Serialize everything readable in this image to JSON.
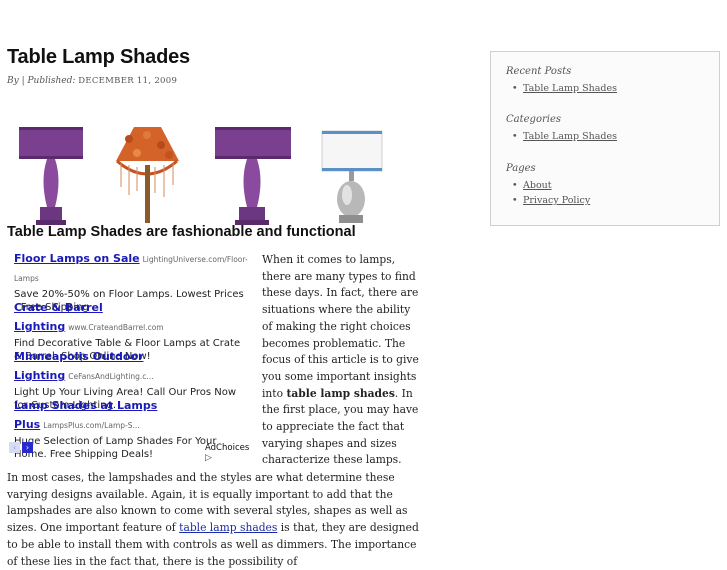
{
  "post": {
    "title": "Table Lamp Shades",
    "meta_by": "By",
    "meta_sep": " | ",
    "meta_published": "Published:",
    "meta_date": "DECEMBER 11, 2009",
    "subheading": "Table Lamp Shades are fashionable and functional",
    "side_para_1": "When it comes to lamps, there are many types to find these days. In fact, there are situations where the ability of making the right choices becomes problematic.  The focus of this article is to give you some important insights into",
    "side_para_bold": "table lamp shades",
    "side_para_2": ". In the first place, you may have to appreciate the fact that varying shapes and sizes characterize these lamps.",
    "body_para_1": "In most cases, the lampshades and the styles are what determine these varying designs available. Again, it is equally important to add that the lampshades are also known to come with several styles, shapes as well as sizes. One important feature of",
    "body_link": "table lamp shades",
    "body_para_2": "is that, they are designed to be able to install them with controls as well as dimmers.  The importance of these lies in the fact that, there is the possibility of"
  },
  "ads": {
    "items": [
      {
        "title": "Floor Lamps on Sale",
        "url": "LightingUniverse.com/Floor-Lamps",
        "desc": "Save 20%-50% on Floor Lamps. Lowest Prices - Free Shipping"
      },
      {
        "title": "Crate & Barrel Lighting",
        "url": "www.CrateandBarrel.com",
        "desc": "Find Decorative Table & Floor Lamps at Crate & Barrel. Shop Online Now!"
      },
      {
        "title": "Minneapolis Outdoor Lighting",
        "url": "CeFansAndLighting.c...",
        "desc": "Light Up Your Living Area! Call Our Pros Now for Custom Lighting."
      },
      {
        "title": "Lamp Shades at Lamps Plus",
        "url": "LampsPlus.com/Lamp-S...",
        "desc": "Huge Selection of Lamp Shades For Your Home. Free Shipping Deals!"
      }
    ],
    "prev_glyph": "‹",
    "next_glyph": "›",
    "adchoices": "AdChoices",
    "adchoices_icon": "▷"
  },
  "sidebar": {
    "recent_title": "Recent Posts",
    "recent_items": [
      "Table Lamp Shades"
    ],
    "categories_title": "Categories",
    "categories_items": [
      "Table Lamp Shades"
    ],
    "pages_title": "Pages",
    "pages_items": [
      "About",
      "Privacy Policy"
    ]
  },
  "colors": {
    "ad_link": "#1a1ab8",
    "body_link": "#1a2ca8",
    "lamp_purple": "#7a3f8e",
    "lamp_orange": "#d4632a"
  }
}
